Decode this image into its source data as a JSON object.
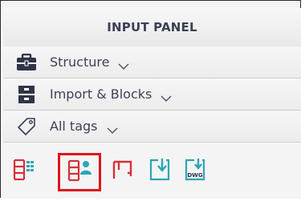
{
  "panel": {
    "title": "INPUT PANEL"
  },
  "sections": [
    {
      "label": "Structure",
      "icon": "toolbox-icon"
    },
    {
      "label": "Import & Blocks",
      "icon": "cabinet-icon"
    },
    {
      "label": "All tags",
      "icon": "tag-icon"
    }
  ],
  "toolbar": {
    "buttons": [
      {
        "icon": "floor-plan-grid-icon",
        "active": false
      },
      {
        "icon": "floor-plan-user-icon",
        "active": true
      },
      {
        "icon": "floor-plan-corner-icon",
        "active": false
      },
      {
        "icon": "import-page-icon",
        "active": false
      },
      {
        "icon": "import-dwg-icon",
        "label": "DWG",
        "active": false
      }
    ]
  },
  "colors": {
    "accent_red": "#d6303a",
    "accent_teal": "#2aa7b5",
    "active_outline": "#e0141b",
    "text": "#3e4258"
  }
}
